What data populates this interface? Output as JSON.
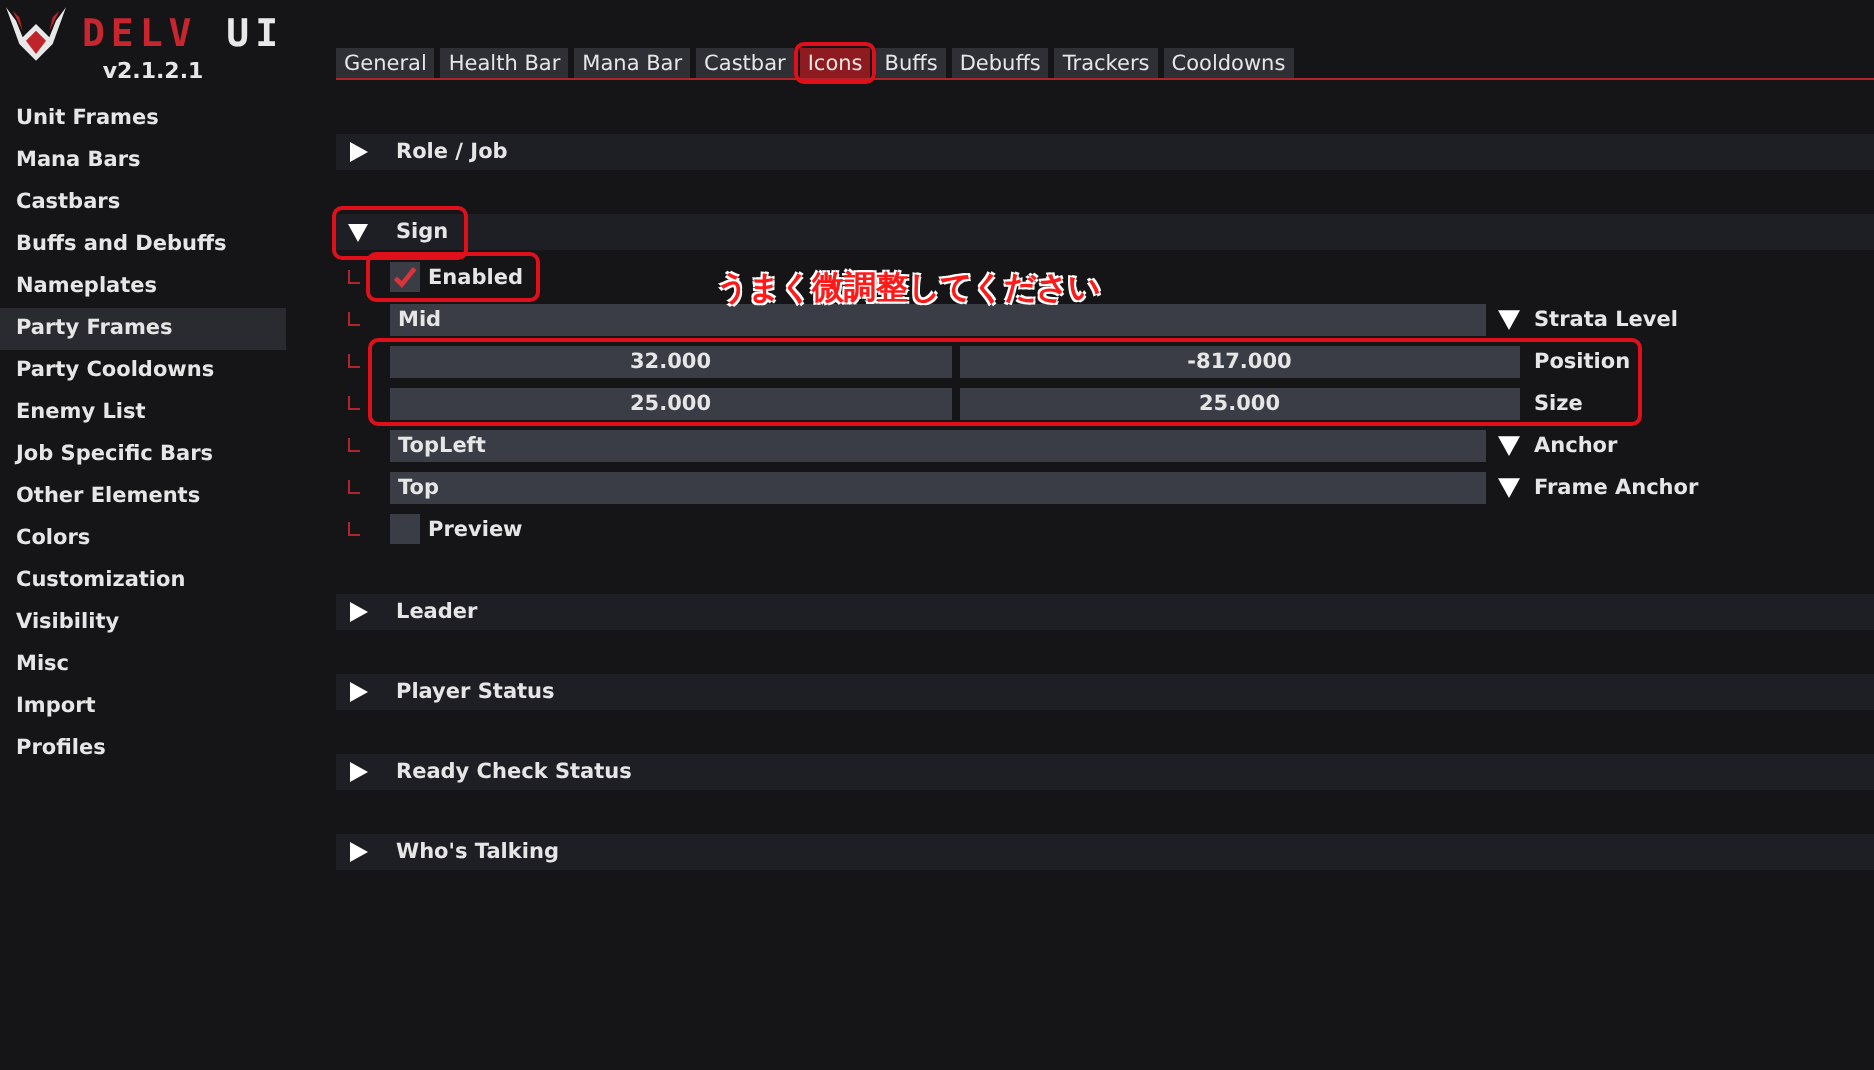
{
  "logo": {
    "name_first": "DELV",
    "name_second": "UI",
    "version": "v2.1.2.1"
  },
  "sidebar": {
    "items": [
      {
        "label": "Unit Frames",
        "selected": false
      },
      {
        "label": "Mana Bars",
        "selected": false
      },
      {
        "label": "Castbars",
        "selected": false
      },
      {
        "label": "Buffs and Debuffs",
        "selected": false
      },
      {
        "label": "Nameplates",
        "selected": false
      },
      {
        "label": "Party Frames",
        "selected": true
      },
      {
        "label": "Party Cooldowns",
        "selected": false
      },
      {
        "label": "Enemy List",
        "selected": false
      },
      {
        "label": "Job Specific Bars",
        "selected": false
      },
      {
        "label": "Other Elements",
        "selected": false
      },
      {
        "label": "Colors",
        "selected": false
      },
      {
        "label": "Customization",
        "selected": false
      },
      {
        "label": "Visibility",
        "selected": false
      },
      {
        "label": "Misc",
        "selected": false
      },
      {
        "label": "Import",
        "selected": false
      },
      {
        "label": "Profiles",
        "selected": false
      }
    ]
  },
  "tabs": [
    {
      "label": "General",
      "selected": false,
      "highlighted": false
    },
    {
      "label": "Health Bar",
      "selected": false,
      "highlighted": false
    },
    {
      "label": "Mana Bar",
      "selected": false,
      "highlighted": false
    },
    {
      "label": "Castbar",
      "selected": false,
      "highlighted": false
    },
    {
      "label": "Icons",
      "selected": true,
      "highlighted": true
    },
    {
      "label": "Buffs",
      "selected": false,
      "highlighted": false
    },
    {
      "label": "Debuffs",
      "selected": false,
      "highlighted": false
    },
    {
      "label": "Trackers",
      "selected": false,
      "highlighted": false
    },
    {
      "label": "Cooldowns",
      "selected": false,
      "highlighted": false
    }
  ],
  "sections": [
    {
      "title": "Role / Job",
      "expanded": false,
      "highlighted": false
    },
    {
      "title": "Sign",
      "expanded": true,
      "highlighted": true,
      "rows": [
        {
          "kind": "checkbox",
          "label": "Enabled",
          "checked": true,
          "highlighted": true
        },
        {
          "kind": "combo",
          "setting": "Strata Level",
          "value": "Mid"
        },
        {
          "kind": "pairs",
          "highlighted": true,
          "items": [
            {
              "setting": "Position",
              "values": [
                "32.000",
                "-817.000"
              ]
            },
            {
              "setting": "Size",
              "values": [
                "25.000",
                "25.000"
              ]
            }
          ]
        },
        {
          "kind": "combo",
          "setting": "Anchor",
          "value": "TopLeft"
        },
        {
          "kind": "combo",
          "setting": "Frame Anchor",
          "value": "Top"
        },
        {
          "kind": "checkbox",
          "label": "Preview",
          "checked": false,
          "highlighted": false
        }
      ]
    },
    {
      "title": "Leader",
      "expanded": false,
      "highlighted": false
    },
    {
      "title": "Player Status",
      "expanded": false,
      "highlighted": false
    },
    {
      "title": "Ready Check Status",
      "expanded": false,
      "highlighted": false
    },
    {
      "title": "Who's Talking",
      "expanded": false,
      "highlighted": false
    }
  ],
  "annotation": {
    "text": "うまく微調整してください"
  }
}
